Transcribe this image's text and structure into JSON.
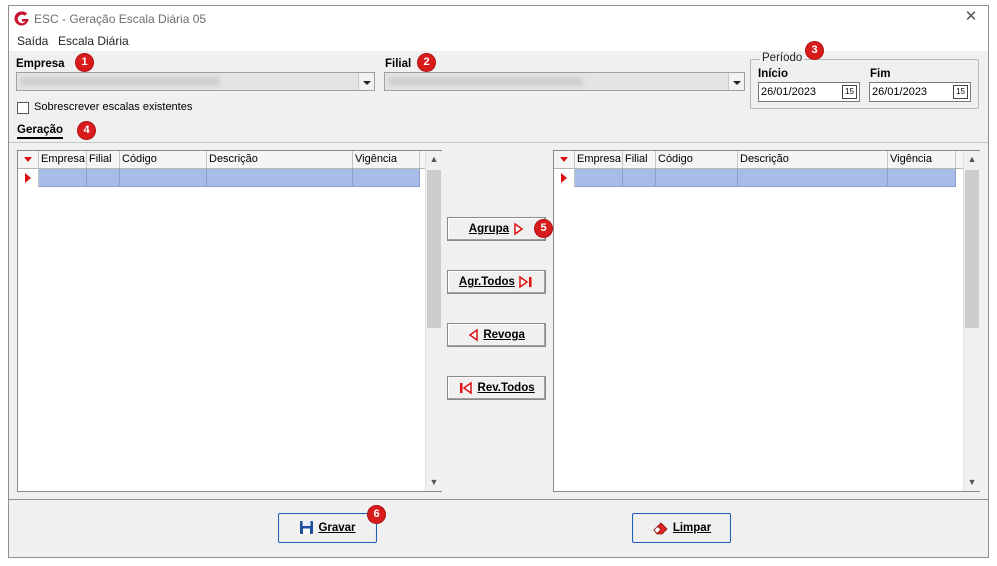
{
  "window": {
    "title": "ESC - Geração Escala Diária 05",
    "close_glyph": "✕"
  },
  "menu": [
    {
      "label": "Saída"
    },
    {
      "label": "Escala Diária"
    }
  ],
  "empresa": {
    "label": "Empresa",
    "badge": "1"
  },
  "filial": {
    "label": "Filial",
    "badge": "2"
  },
  "periodo": {
    "title": "Período",
    "badge": "3",
    "inicio_label": "Início",
    "inicio_value": "26/01/2023",
    "fim_label": "Fim",
    "fim_value": "26/01/2023",
    "calendar_glyph": "15"
  },
  "overwrite": {
    "label": "Sobrescrever escalas existentes",
    "checked": false
  },
  "tabs": {
    "geracao": "Geração",
    "badge": "4"
  },
  "left_grid": {
    "columns": [
      "Empresa",
      "Filial",
      "Código",
      "Descrição",
      "Vigência"
    ]
  },
  "right_grid": {
    "columns": [
      "Empresa",
      "Filial",
      "Código",
      "Descrição",
      "Vigência"
    ]
  },
  "actions": {
    "agrupa": "Agrupa",
    "agrupa_badge": "5",
    "agr_todos": "Agr.Todos",
    "revoga": "Revoga",
    "rev_todos": "Rev.Todos"
  },
  "footer": {
    "gravar": "Gravar",
    "gravar_badge": "6",
    "limpar": "Limpar"
  },
  "colors": {
    "accent_red": "#d81c1c",
    "selected_row": "#a7bde8",
    "focus_blue": "#1e5fb4"
  },
  "icons": [
    "app-logo-icon",
    "close-icon",
    "chevron-down-icon",
    "calendar-icon",
    "arrow-right-icon",
    "arrow-right-all-icon",
    "arrow-left-icon",
    "arrow-left-all-icon",
    "save-icon",
    "eraser-icon"
  ]
}
